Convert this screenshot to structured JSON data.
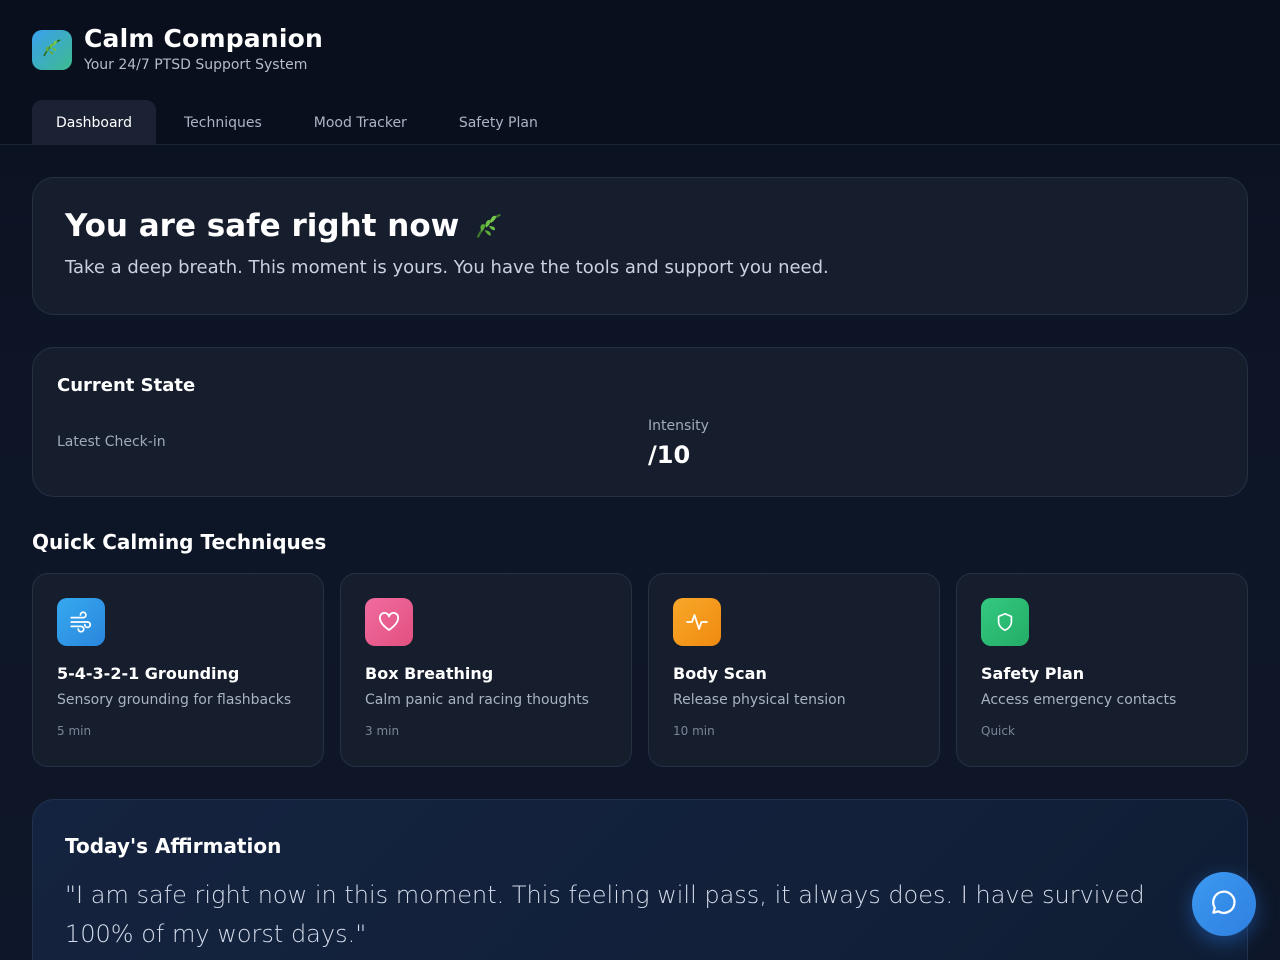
{
  "app": {
    "title": "Calm Companion",
    "subtitle": "Your 24/7 PTSD Support System",
    "logo_icon": "leaf-icon"
  },
  "tabs": [
    {
      "label": "Dashboard",
      "active": true
    },
    {
      "label": "Techniques",
      "active": false
    },
    {
      "label": "Mood Tracker",
      "active": false
    },
    {
      "label": "Safety Plan",
      "active": false
    }
  ],
  "hero": {
    "title": "You are safe right now",
    "text": "Take a deep breath. This moment is yours. You have the tools and support you need."
  },
  "current_state": {
    "title": "Current State",
    "latest_label": "Latest Check-in",
    "intensity_label": "Intensity",
    "intensity_value": "/10"
  },
  "techniques": {
    "section_title": "Quick Calming Techniques",
    "items": [
      {
        "name": "5-4-3-2-1 Grounding",
        "desc": "Sensory grounding for flashbacks",
        "time": "5 min",
        "icon": "wind-icon",
        "color": "#2f9be8"
      },
      {
        "name": "Box Breathing",
        "desc": "Calm panic and racing thoughts",
        "time": "3 min",
        "icon": "heart-icon",
        "color": "#ec5f96"
      },
      {
        "name": "Body Scan",
        "desc": "Release physical tension",
        "time": "10 min",
        "icon": "pulse-icon",
        "color": "#f59a1b"
      },
      {
        "name": "Safety Plan",
        "desc": "Access emergency contacts",
        "time": "Quick",
        "icon": "shield-icon",
        "color": "#2fc076"
      }
    ]
  },
  "affirmation": {
    "title": "Today's Affirmation",
    "text": "\"I am safe right now in this moment. This feeling will pass, it always does. I have survived 100% of my worst days.\""
  },
  "chat": {
    "icon": "chat-bubble-icon"
  }
}
